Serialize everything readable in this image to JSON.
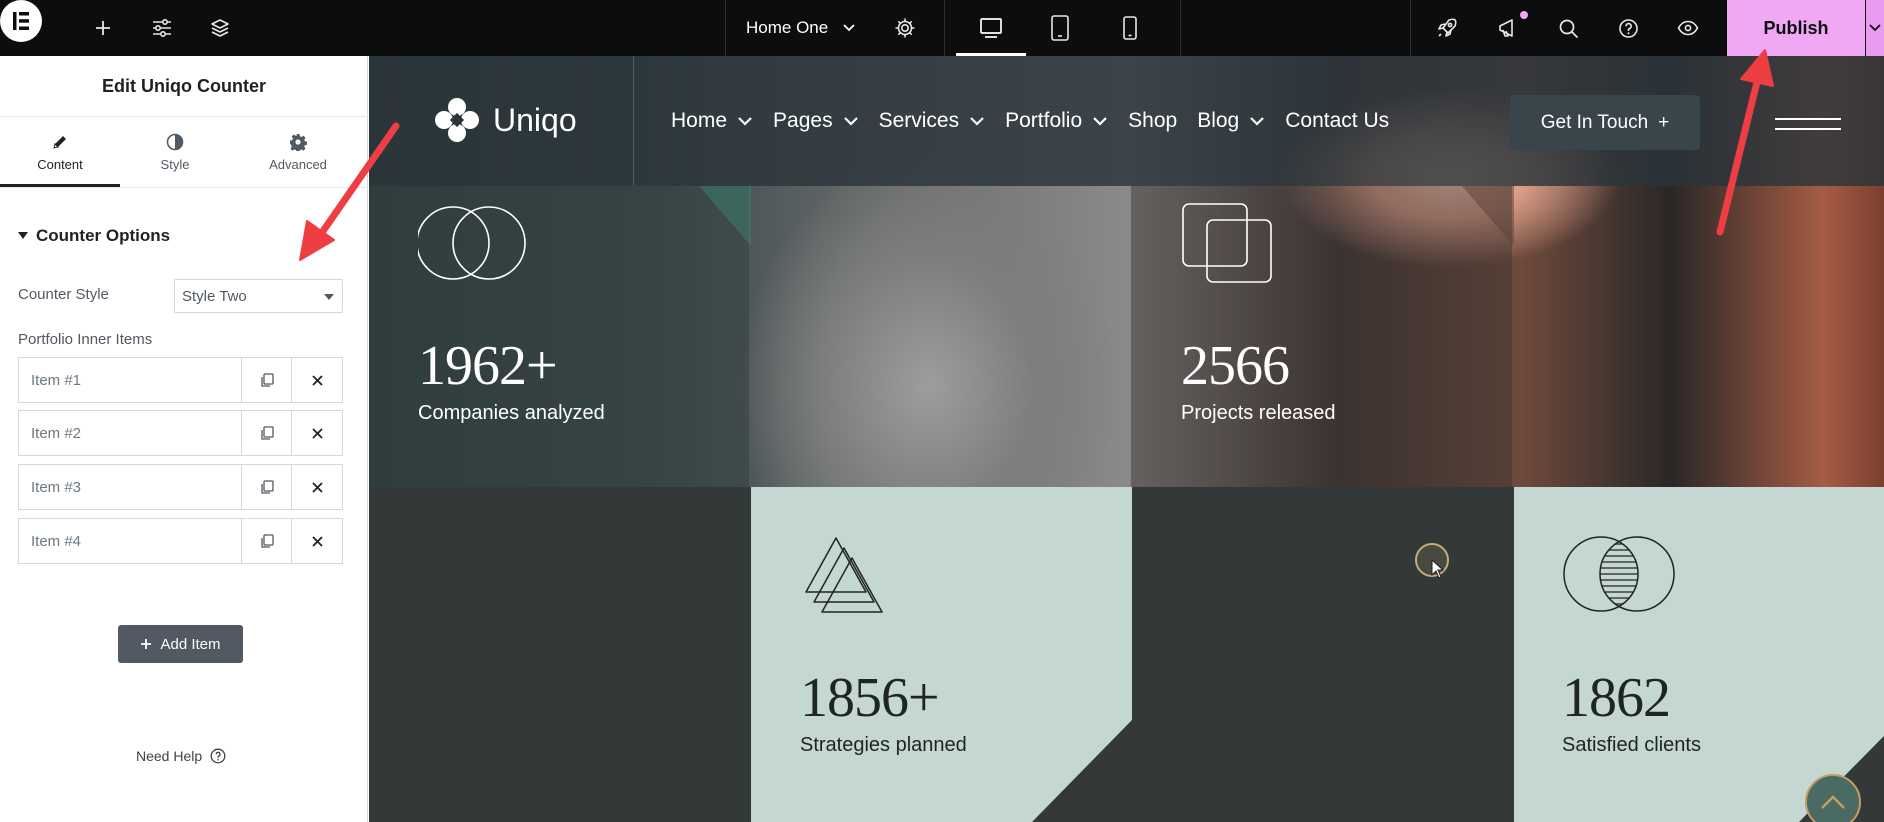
{
  "topbar": {
    "page_name": "Home One",
    "publish_label": "Publish",
    "icons": [
      "elementor-logo-icon",
      "add-icon",
      "settings-sliders-icon",
      "layers-icon",
      "settings-gear-icon",
      "desktop-icon",
      "tablet-icon",
      "mobile-icon",
      "rocket-icon",
      "announcement-icon",
      "search-icon",
      "help-icon",
      "preview-eye-icon",
      "chevron-down-icon"
    ],
    "accent_color": "#f0a8f5"
  },
  "panel": {
    "title": "Edit Uniqo Counter",
    "tabs": [
      {
        "label": "Content",
        "icon": "pencil-icon",
        "active": true
      },
      {
        "label": "Style",
        "icon": "half-circle-icon",
        "active": false
      },
      {
        "label": "Advanced",
        "icon": "gear-icon",
        "active": false
      }
    ],
    "section_title": "Counter Options",
    "counter_style_label": "Counter Style",
    "counter_style_value": "Style Two",
    "repeater_label": "Portfolio Inner Items",
    "items": [
      {
        "title": "Item #1"
      },
      {
        "title": "Item #2"
      },
      {
        "title": "Item #3"
      },
      {
        "title": "Item #4"
      }
    ],
    "add_item_label": "Add Item",
    "need_help_label": "Need Help"
  },
  "site": {
    "logo_text": "Uniqo",
    "nav": [
      {
        "label": "Home",
        "dropdown": true
      },
      {
        "label": "Pages",
        "dropdown": true
      },
      {
        "label": "Services",
        "dropdown": true
      },
      {
        "label": "Portfolio",
        "dropdown": true
      },
      {
        "label": "Shop",
        "dropdown": false
      },
      {
        "label": "Blog",
        "dropdown": true
      },
      {
        "label": "Contact Us",
        "dropdown": false
      }
    ],
    "cta_label": "Get In Touch",
    "cta_plus": "+",
    "counters": [
      {
        "number": "1962+",
        "label": "Companies analyzed",
        "icon": "overlapping-circles-icon"
      },
      {
        "number": "2566",
        "label": "Projects released",
        "icon": "overlapping-squares-icon"
      },
      {
        "number": "1856+",
        "label": "Strategies planned",
        "icon": "stacked-triangles-icon"
      },
      {
        "number": "1862",
        "label": "Satisfied clients",
        "icon": "striped-circles-icon"
      }
    ],
    "colors": {
      "light_tile": "#c4d7d2",
      "dark_tile": "#333838",
      "header": "#2b343a"
    }
  }
}
